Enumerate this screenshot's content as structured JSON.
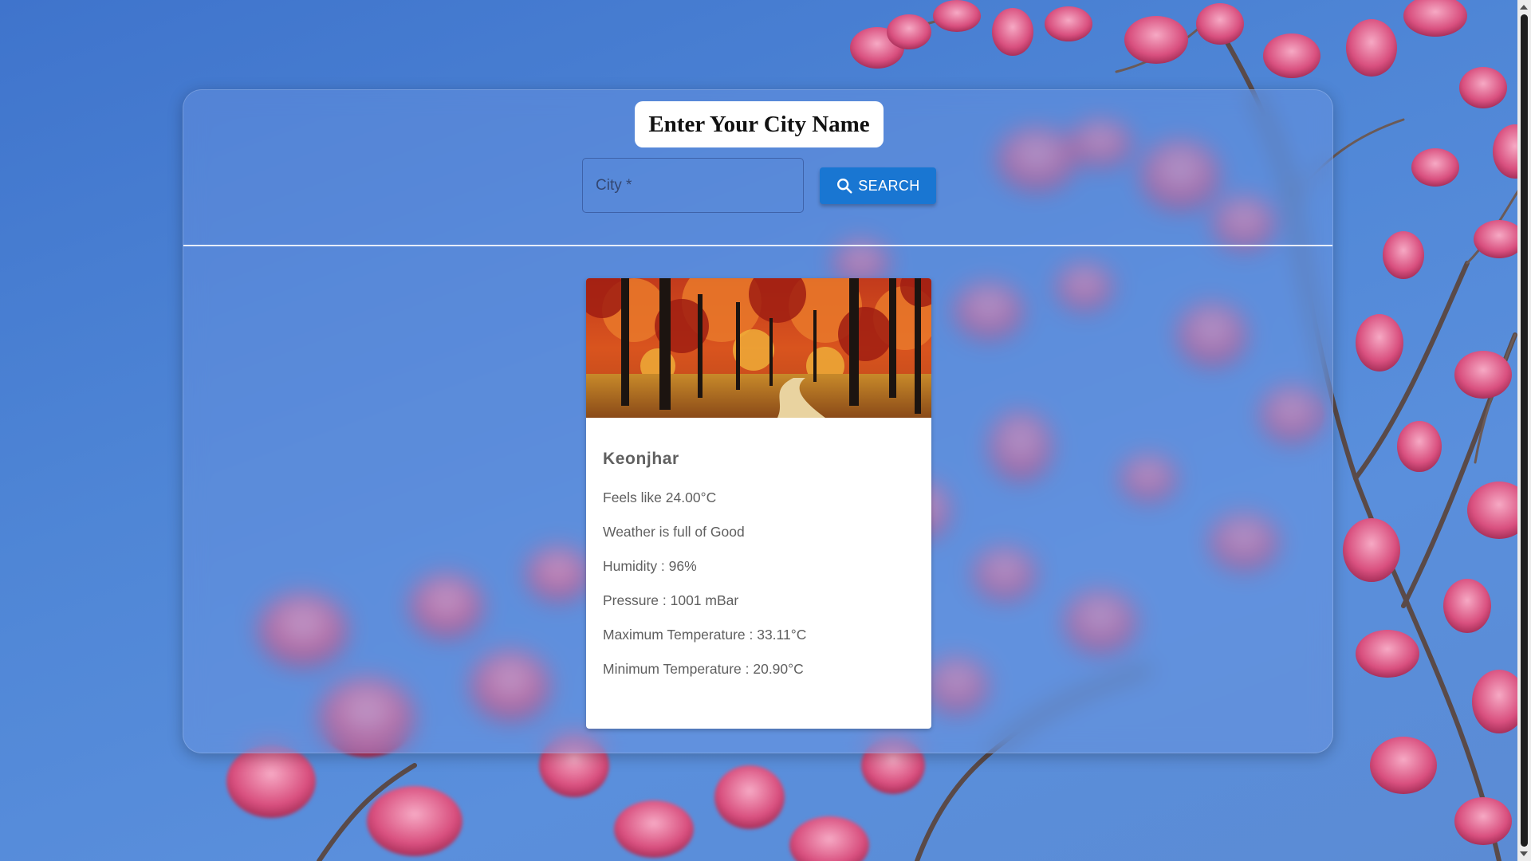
{
  "header": {
    "title": "Enter Your City Name"
  },
  "search": {
    "placeholder": "City *",
    "value": "",
    "button_label": "SEARCH",
    "button_icon": "search-icon"
  },
  "weather_card": {
    "image": "autumn-forest-image",
    "city": "Keonjhar",
    "lines": [
      "Feels like 24.00°C",
      "Weather is full of Good",
      "Humidity : 96%",
      "Pressure : 1001 mBar",
      "Maximum Temperature : 33.11°C",
      "Minimum Temperature : 20.90°C"
    ]
  },
  "colors": {
    "accent": "#1976d2",
    "background": "#4a7fd0",
    "card": "#ffffff",
    "text": "#5f5f5f"
  }
}
